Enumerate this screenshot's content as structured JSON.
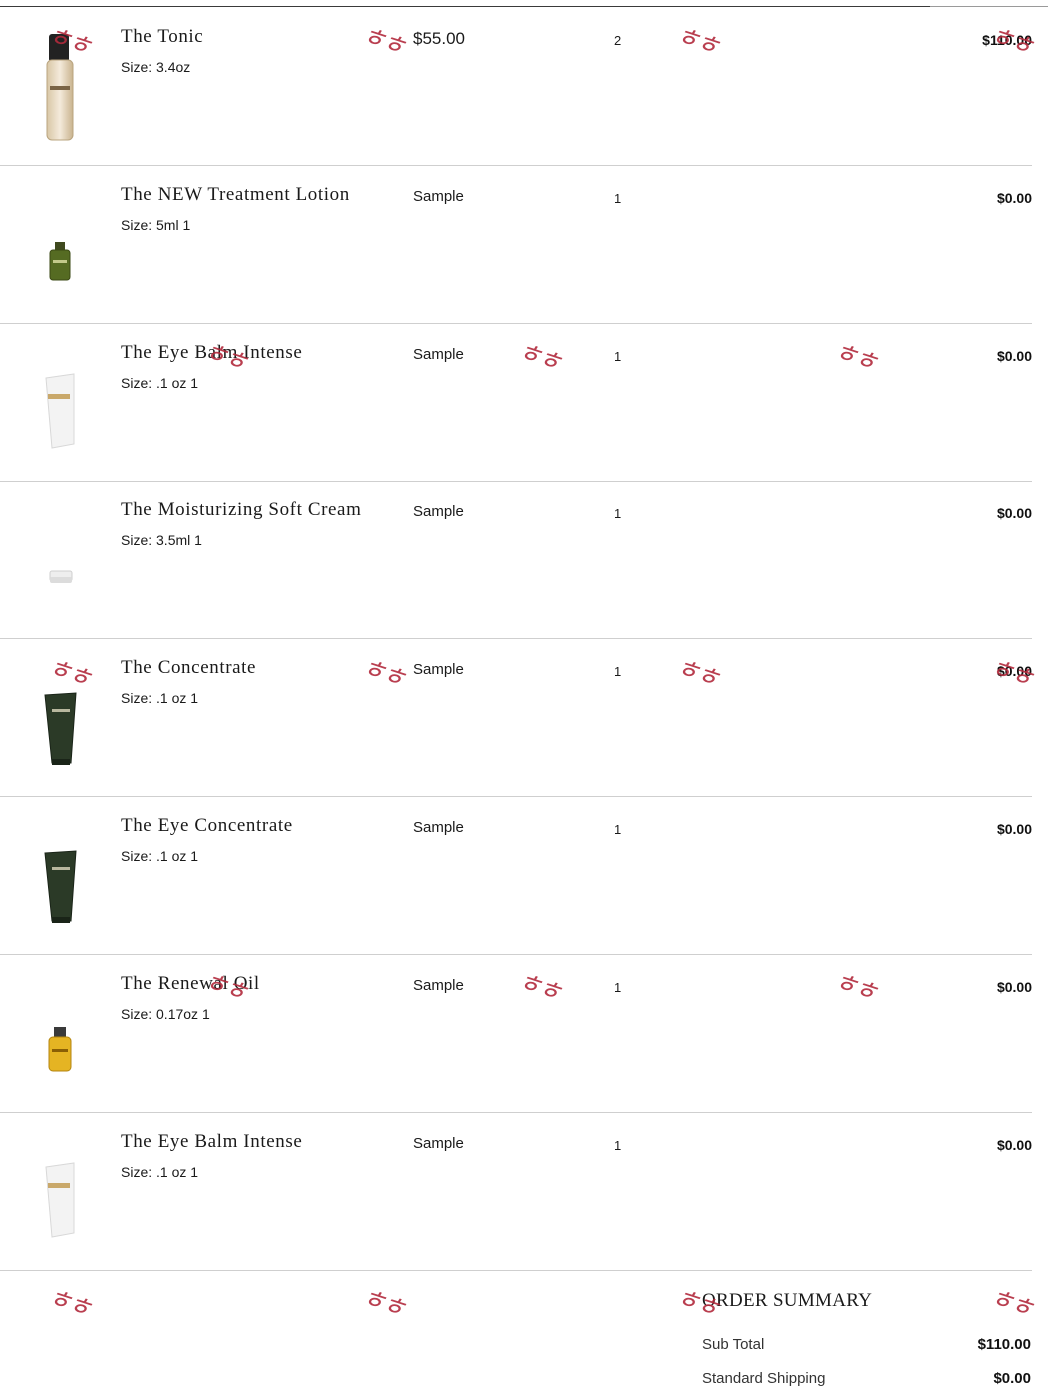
{
  "cart": {
    "items": [
      {
        "name": "The Tonic",
        "size": "Size: 3.4oz",
        "price": "$55.00",
        "qty": "2",
        "total": "$110.00",
        "icon": "tonic-bottle-icon"
      },
      {
        "name": "The NEW Treatment Lotion",
        "size": "Size: 5ml 1",
        "price": "Sample",
        "qty": "1",
        "total": "$0.00",
        "icon": "lotion-bottle-icon"
      },
      {
        "name": "The Eye Balm Intense",
        "size": "Size: .1 oz 1",
        "price": "Sample",
        "qty": "1",
        "total": "$0.00",
        "icon": "white-tube-icon"
      },
      {
        "name": "The Moisturizing Soft Cream",
        "size": "Size: 3.5ml 1",
        "price": "Sample",
        "qty": "1",
        "total": "$0.00",
        "icon": "cream-jar-icon"
      },
      {
        "name": "The Concentrate",
        "size": "Size: .1 oz 1",
        "price": "Sample",
        "qty": "1",
        "total": "$0.00",
        "icon": "dark-tube-icon"
      },
      {
        "name": "The Eye Concentrate",
        "size": "Size: .1 oz 1",
        "price": "Sample",
        "qty": "1",
        "total": "$0.00",
        "icon": "dark-tube-icon"
      },
      {
        "name": "The Renewal Oil",
        "size": "Size: 0.17oz 1",
        "price": "Sample",
        "qty": "1",
        "total": "$0.00",
        "icon": "oil-bottle-icon"
      },
      {
        "name": "The Eye Balm Intense",
        "size": "Size: .1 oz 1",
        "price": "Sample",
        "qty": "1",
        "total": "$0.00",
        "icon": "white-tube-icon"
      }
    ]
  },
  "summary": {
    "title": "ORDER SUMMARY",
    "subtotal_label": "Sub Total",
    "subtotal_value": "$110.00",
    "shipping_label": "Standard Shipping",
    "shipping_value": "$0.00"
  },
  "watermark": {
    "text": "ㅎㅎ",
    "color": "#b22a3c"
  }
}
